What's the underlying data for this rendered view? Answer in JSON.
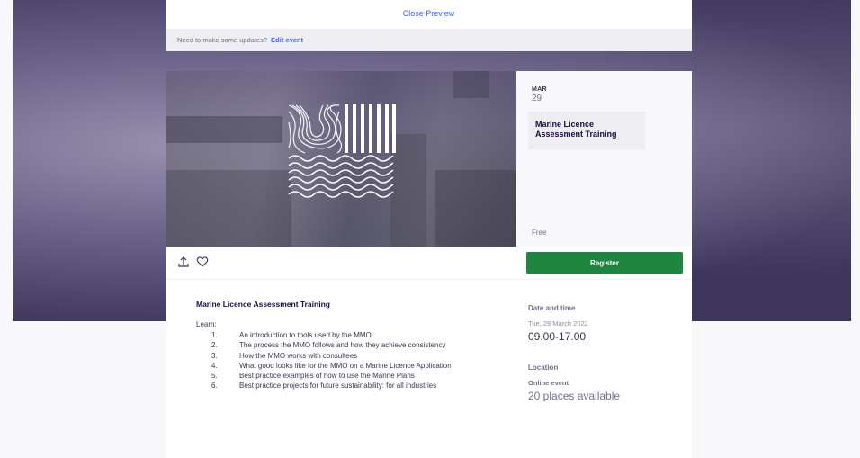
{
  "preview": {
    "close_label": "Close Preview",
    "update_text": "Need to make some updates?",
    "edit_label": "Edit event"
  },
  "event": {
    "month": "MAR",
    "day": "29",
    "title": "Marine Licence Assessment Training",
    "price": "Free",
    "register_label": "Register"
  },
  "description": {
    "title": "Marine Licence Assessment Training",
    "learn_label": "Learn:",
    "items": [
      {
        "num": "1.",
        "text": "An introduction to tools used by the MMO"
      },
      {
        "num": "2.",
        "text": "The process the MMO follows and how they achieve consistency"
      },
      {
        "num": "3.",
        "text": "How the MMO works with consultees"
      },
      {
        "num": "4.",
        "text": "What good looks like for the MMO on a Marine Licence Application"
      },
      {
        "num": "5.",
        "text": "Best practice examples of how to use the Marine Plans"
      },
      {
        "num": "6.",
        "text": "Best practice projects for future sustainability: for all industries"
      }
    ]
  },
  "details": {
    "date_heading": "Date and time",
    "date": "Tue, 29 March 2022",
    "time": "09.00-17.00",
    "location_heading": "Location",
    "location": "Online event",
    "places": "20 places available"
  },
  "icons": {
    "share": "share-icon",
    "like": "heart-icon"
  },
  "colors": {
    "register": "#1e8540",
    "link": "#3d64ff"
  }
}
